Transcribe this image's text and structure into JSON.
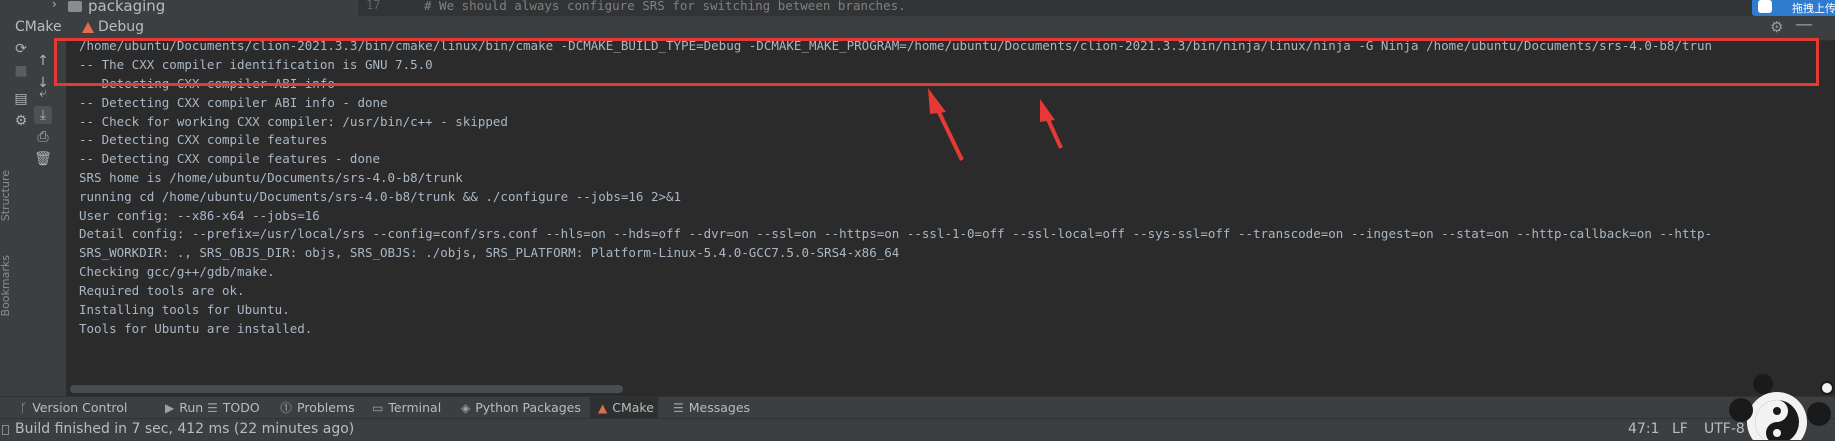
{
  "editor_strip": {
    "tree_item": "packaging",
    "line_number": "17",
    "code_line": "# We should always configure SRS for switching between branches.",
    "badge_text": "拖拽上传"
  },
  "tool_window": {
    "title": "CMake",
    "tab": "Debug"
  },
  "side_labels": [
    "Structure",
    "Bookmarks"
  ],
  "console_lines": [
    "/home/ubuntu/Documents/clion-2021.3.3/bin/cmake/linux/bin/cmake -DCMAKE_BUILD_TYPE=Debug -DCMAKE_MAKE_PROGRAM=/home/ubuntu/Documents/clion-2021.3.3/bin/ninja/linux/ninja -G Ninja /home/ubuntu/Documents/srs-4.0-b8/trun",
    "-- The CXX compiler identification is GNU 7.5.0",
    "-- Detecting CXX compiler ABI info",
    "-- Detecting CXX compiler ABI info - done",
    "-- Check for working CXX compiler: /usr/bin/c++ - skipped",
    "-- Detecting CXX compile features",
    "-- Detecting CXX compile features - done",
    "SRS home is /home/ubuntu/Documents/srs-4.0-b8/trunk",
    "running cd /home/ubuntu/Documents/srs-4.0-b8/trunk && ./configure --jobs=16 2>&1",
    "User config: --x86-x64 --jobs=16",
    "Detail config: --prefix=/usr/local/srs --config=conf/srs.conf --hls=on --hds=off --dvr=on --ssl=on --https=on --ssl-1-0=off --ssl-local=off --sys-ssl=off --transcode=on --ingest=on --stat=on --http-callback=on --http-",
    "SRS_WORKDIR: ., SRS_OBJS_DIR: objs, SRS_OBJS: ./objs, SRS_PLATFORM: Platform-Linux-5.4.0-GCC7.5.0-SRS4-x86_64",
    "Checking gcc/g++/gdb/make.",
    "Required tools are ok.",
    "Installing tools for Ubuntu.",
    "Tools for Ubuntu are installed."
  ],
  "bottom_tabs": [
    {
      "label": "Version Control",
      "icon": "branch-icon"
    },
    {
      "label": "Run",
      "icon": "run-icon"
    },
    {
      "label": "TODO",
      "icon": "list-icon"
    },
    {
      "label": "Problems",
      "icon": "warning-icon"
    },
    {
      "label": "Terminal",
      "icon": "terminal-icon"
    },
    {
      "label": "Python Packages",
      "icon": "layers-icon"
    },
    {
      "label": "CMake",
      "icon": "cmake-icon"
    },
    {
      "label": "Messages",
      "icon": "messages-icon"
    }
  ],
  "status_bar": {
    "message": "Build finished in 7 sec, 412 ms (22 minutes ago)",
    "position": "47:1",
    "line_ending": "LF",
    "encoding": "UTF-8"
  },
  "colors": {
    "highlight": "#e53935",
    "cmake_accent": "#e06c4b",
    "badge": "#2e7bcf"
  }
}
